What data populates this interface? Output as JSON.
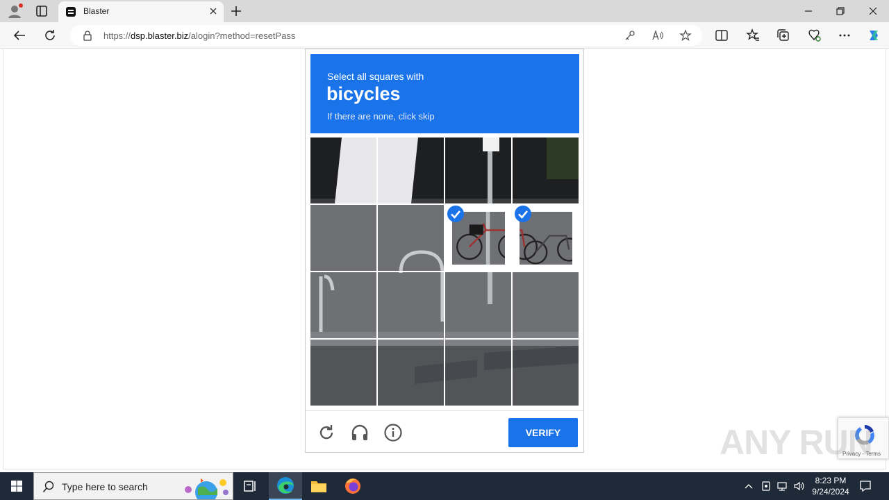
{
  "browser": {
    "tab_title": "Blaster",
    "url_prefix": "https://",
    "url_domain": "dsp.blaster.biz",
    "url_path": "/alogin?method=resetPass",
    "accent_color": "#1a73e8"
  },
  "challenge": {
    "instruction": "Select all squares with",
    "object": "bicycles",
    "hint": "If there are none, click skip",
    "grid_rows": 4,
    "grid_cols": 4,
    "selected_tiles": [
      6,
      7
    ],
    "verify_label": "VERIFY",
    "footer_icons": [
      "reload-icon",
      "headphones-icon",
      "info-icon"
    ]
  },
  "recaptcha_badge": {
    "text": "Privacy - Terms"
  },
  "watermark": "ANY RUN",
  "taskbar": {
    "search_placeholder": "Type here to search",
    "time": "8:23 PM",
    "date": "9/24/2024"
  }
}
